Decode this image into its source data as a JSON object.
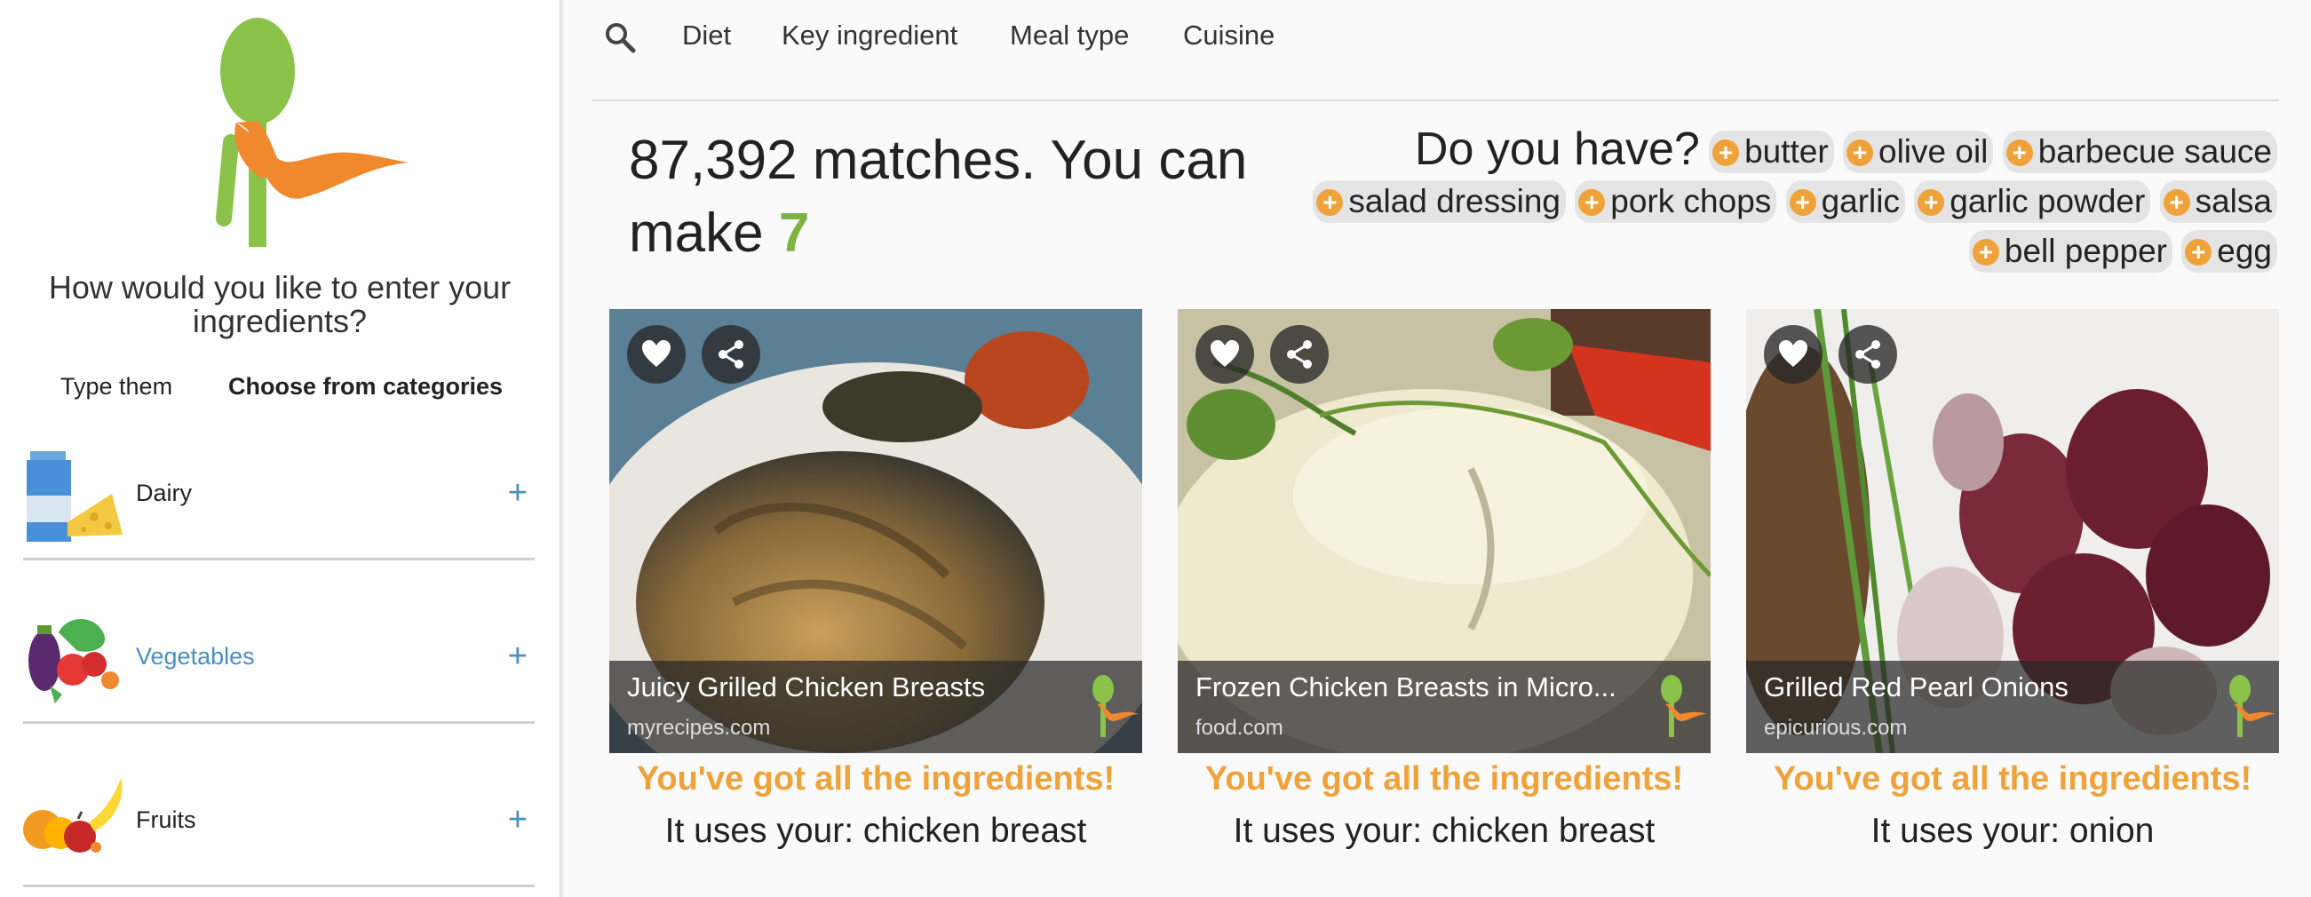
{
  "sidebar": {
    "prompt": "How would you like to enter your ingredients?",
    "modes": [
      "Type them",
      "Choose from categories"
    ],
    "categories": [
      {
        "label": "Dairy",
        "icon": "dairy-icon",
        "active": false
      },
      {
        "label": "Vegetables",
        "icon": "vegetables-icon",
        "active": true
      },
      {
        "label": "Fruits",
        "icon": "fruits-icon",
        "active": false
      }
    ],
    "plus_glyph": "+"
  },
  "nav": {
    "items": [
      "Diet",
      "Key ingredient",
      "Meal type",
      "Cuisine"
    ]
  },
  "results": {
    "matches_text": "87,392 matches. You can make",
    "make_count": "7"
  },
  "suggestions": {
    "question": "Do you have?",
    "items": [
      "butter",
      "olive oil",
      "barbecue sauce",
      "salad dressing",
      "pork chops",
      "garlic",
      "garlic powder",
      "salsa",
      "bell pepper",
      "egg"
    ]
  },
  "cards": [
    {
      "title": "Juicy Grilled Chicken Breasts",
      "source": "myrecipes.com",
      "status": "You've got all the ingredients!",
      "uses": "It uses your: chicken breast"
    },
    {
      "title": "Frozen Chicken Breasts in Micro...",
      "source": "food.com",
      "status": "You've got all the ingredients!",
      "uses": "It uses your: chicken breast"
    },
    {
      "title": "Grilled Red Pearl Onions",
      "source": "epicurious.com",
      "status": "You've got all the ingredients!",
      "uses": "It uses your: onion"
    }
  ],
  "colors": {
    "brand_green": "#8bc34a",
    "brand_orange": "#f0892e",
    "accent_orange": "#f0a23a",
    "link_blue": "#4a90c2",
    "count_green": "#7cb342"
  }
}
